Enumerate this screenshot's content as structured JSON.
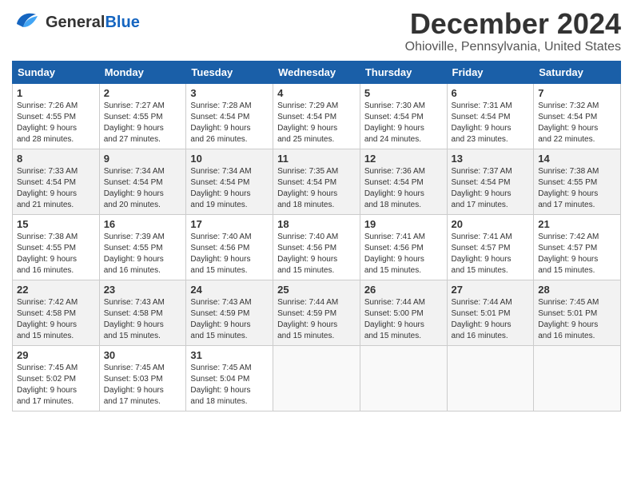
{
  "header": {
    "logo_general": "General",
    "logo_blue": "Blue",
    "month": "December 2024",
    "location": "Ohioville, Pennsylvania, United States"
  },
  "weekdays": [
    "Sunday",
    "Monday",
    "Tuesday",
    "Wednesday",
    "Thursday",
    "Friday",
    "Saturday"
  ],
  "weeks": [
    [
      {
        "day": "1",
        "info": "Sunrise: 7:26 AM\nSunset: 4:55 PM\nDaylight: 9 hours\nand 28 minutes."
      },
      {
        "day": "2",
        "info": "Sunrise: 7:27 AM\nSunset: 4:55 PM\nDaylight: 9 hours\nand 27 minutes."
      },
      {
        "day": "3",
        "info": "Sunrise: 7:28 AM\nSunset: 4:54 PM\nDaylight: 9 hours\nand 26 minutes."
      },
      {
        "day": "4",
        "info": "Sunrise: 7:29 AM\nSunset: 4:54 PM\nDaylight: 9 hours\nand 25 minutes."
      },
      {
        "day": "5",
        "info": "Sunrise: 7:30 AM\nSunset: 4:54 PM\nDaylight: 9 hours\nand 24 minutes."
      },
      {
        "day": "6",
        "info": "Sunrise: 7:31 AM\nSunset: 4:54 PM\nDaylight: 9 hours\nand 23 minutes."
      },
      {
        "day": "7",
        "info": "Sunrise: 7:32 AM\nSunset: 4:54 PM\nDaylight: 9 hours\nand 22 minutes."
      }
    ],
    [
      {
        "day": "8",
        "info": "Sunrise: 7:33 AM\nSunset: 4:54 PM\nDaylight: 9 hours\nand 21 minutes."
      },
      {
        "day": "9",
        "info": "Sunrise: 7:34 AM\nSunset: 4:54 PM\nDaylight: 9 hours\nand 20 minutes."
      },
      {
        "day": "10",
        "info": "Sunrise: 7:34 AM\nSunset: 4:54 PM\nDaylight: 9 hours\nand 19 minutes."
      },
      {
        "day": "11",
        "info": "Sunrise: 7:35 AM\nSunset: 4:54 PM\nDaylight: 9 hours\nand 18 minutes."
      },
      {
        "day": "12",
        "info": "Sunrise: 7:36 AM\nSunset: 4:54 PM\nDaylight: 9 hours\nand 18 minutes."
      },
      {
        "day": "13",
        "info": "Sunrise: 7:37 AM\nSunset: 4:54 PM\nDaylight: 9 hours\nand 17 minutes."
      },
      {
        "day": "14",
        "info": "Sunrise: 7:38 AM\nSunset: 4:55 PM\nDaylight: 9 hours\nand 17 minutes."
      }
    ],
    [
      {
        "day": "15",
        "info": "Sunrise: 7:38 AM\nSunset: 4:55 PM\nDaylight: 9 hours\nand 16 minutes."
      },
      {
        "day": "16",
        "info": "Sunrise: 7:39 AM\nSunset: 4:55 PM\nDaylight: 9 hours\nand 16 minutes."
      },
      {
        "day": "17",
        "info": "Sunrise: 7:40 AM\nSunset: 4:56 PM\nDaylight: 9 hours\nand 15 minutes."
      },
      {
        "day": "18",
        "info": "Sunrise: 7:40 AM\nSunset: 4:56 PM\nDaylight: 9 hours\nand 15 minutes."
      },
      {
        "day": "19",
        "info": "Sunrise: 7:41 AM\nSunset: 4:56 PM\nDaylight: 9 hours\nand 15 minutes."
      },
      {
        "day": "20",
        "info": "Sunrise: 7:41 AM\nSunset: 4:57 PM\nDaylight: 9 hours\nand 15 minutes."
      },
      {
        "day": "21",
        "info": "Sunrise: 7:42 AM\nSunset: 4:57 PM\nDaylight: 9 hours\nand 15 minutes."
      }
    ],
    [
      {
        "day": "22",
        "info": "Sunrise: 7:42 AM\nSunset: 4:58 PM\nDaylight: 9 hours\nand 15 minutes."
      },
      {
        "day": "23",
        "info": "Sunrise: 7:43 AM\nSunset: 4:58 PM\nDaylight: 9 hours\nand 15 minutes."
      },
      {
        "day": "24",
        "info": "Sunrise: 7:43 AM\nSunset: 4:59 PM\nDaylight: 9 hours\nand 15 minutes."
      },
      {
        "day": "25",
        "info": "Sunrise: 7:44 AM\nSunset: 4:59 PM\nDaylight: 9 hours\nand 15 minutes."
      },
      {
        "day": "26",
        "info": "Sunrise: 7:44 AM\nSunset: 5:00 PM\nDaylight: 9 hours\nand 15 minutes."
      },
      {
        "day": "27",
        "info": "Sunrise: 7:44 AM\nSunset: 5:01 PM\nDaylight: 9 hours\nand 16 minutes."
      },
      {
        "day": "28",
        "info": "Sunrise: 7:45 AM\nSunset: 5:01 PM\nDaylight: 9 hours\nand 16 minutes."
      }
    ],
    [
      {
        "day": "29",
        "info": "Sunrise: 7:45 AM\nSunset: 5:02 PM\nDaylight: 9 hours\nand 17 minutes."
      },
      {
        "day": "30",
        "info": "Sunrise: 7:45 AM\nSunset: 5:03 PM\nDaylight: 9 hours\nand 17 minutes."
      },
      {
        "day": "31",
        "info": "Sunrise: 7:45 AM\nSunset: 5:04 PM\nDaylight: 9 hours\nand 18 minutes."
      },
      {
        "day": "",
        "info": ""
      },
      {
        "day": "",
        "info": ""
      },
      {
        "day": "",
        "info": ""
      },
      {
        "day": "",
        "info": ""
      }
    ]
  ]
}
